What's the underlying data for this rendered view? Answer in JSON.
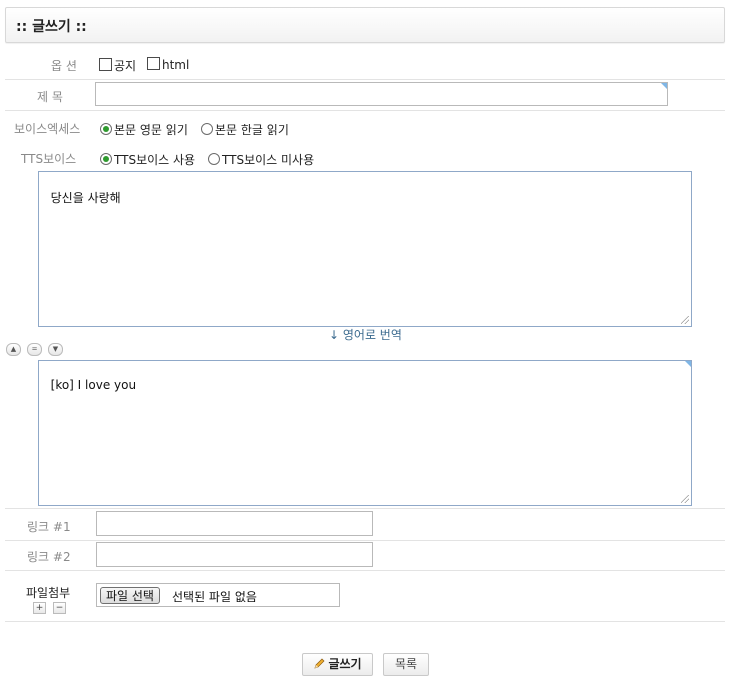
{
  "title": ":: 글쓰기 ::",
  "options": {
    "label": "옵 션",
    "notice": "공지",
    "html": "html"
  },
  "subject": {
    "label": "제 목",
    "value": ""
  },
  "voice_access": {
    "label": "보이스엑세스",
    "opt1": "본문 영문 읽기",
    "opt2": "본문 한글 읽기",
    "selected": "opt1"
  },
  "tts_voice": {
    "label": "TTS보이스",
    "opt1": "TTS보이스 사용",
    "opt2": "TTS보이스 미사용",
    "selected": "opt1"
  },
  "content_ko": "당신을 사랑해",
  "translate_label": "↓ 영어로 번역",
  "size_controls": {
    "up": "▲",
    "reset": "=",
    "down": "▼"
  },
  "content_en": "[ko] I love you",
  "link1": {
    "label": "링크 #1",
    "value": ""
  },
  "link2": {
    "label": "링크 #2",
    "value": ""
  },
  "attachment": {
    "label": "파일첨부",
    "add": "+",
    "remove": "−",
    "choose_button": "파일 선택",
    "status": "선택된 파일 없음"
  },
  "buttons": {
    "write": "글쓰기",
    "list": "목록"
  }
}
